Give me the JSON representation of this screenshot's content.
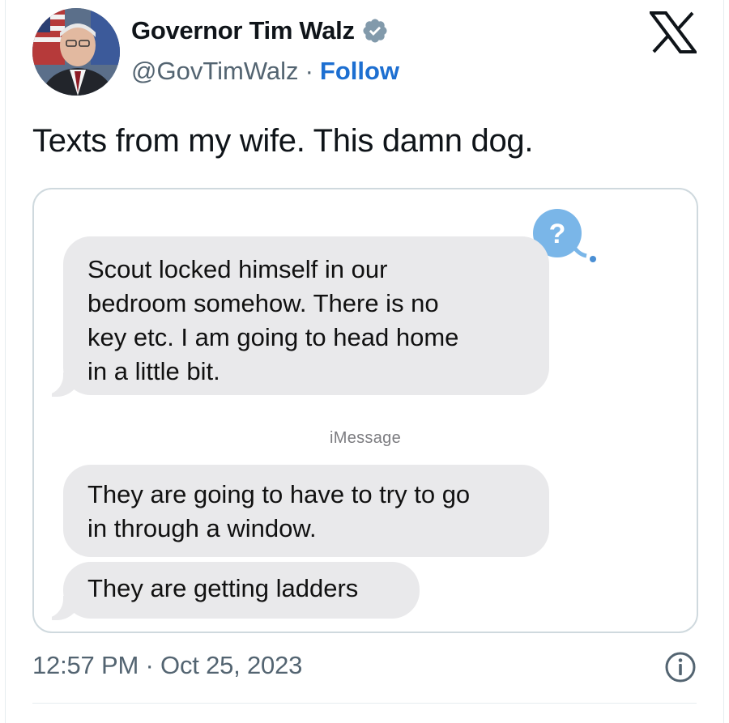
{
  "author": {
    "display_name": "Governor Tim Walz",
    "handle": "@GovTimWalz",
    "separator": "·",
    "follow_label": "Follow",
    "verified_color": "#829aab"
  },
  "platform": {
    "logo_icon": "x-logo-icon"
  },
  "tweet": {
    "text": "Texts from my wife. This damn dog."
  },
  "messages": {
    "bubble_1": "Scout locked himself in our\nbedroom somehow.  There is no\nkey etc.   I am going to head home\nin a little bit.",
    "service_label": "iMessage",
    "bubble_2": "They are going to have to try to go\nin through a window.",
    "bubble_3": "They are getting ladders",
    "unknown_contact_icon": "question-mark-icon",
    "badge_color": "#7ab6e8",
    "bubble_color": "#e9e9eb"
  },
  "footer": {
    "timestamp": "12:57 PM · Oct 25, 2023",
    "info_icon": "info-icon"
  }
}
